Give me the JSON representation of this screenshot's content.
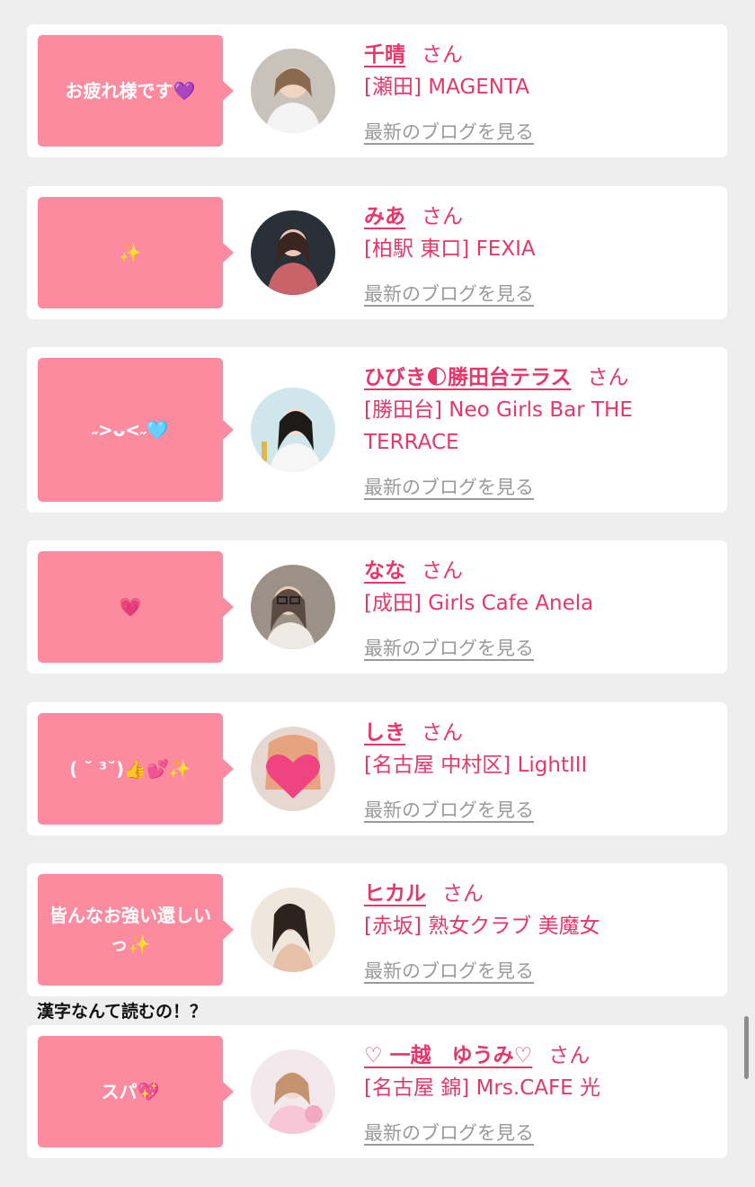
{
  "blog_link_label": "最新のブログを見る",
  "san_label": "さん",
  "colors": {
    "bubble": "#fc8b9f",
    "name": "#e8366a",
    "link": "#9a9a9a",
    "background": "#eeeeee"
  },
  "cards": [
    {
      "message": "お疲れ様です💜",
      "name": "千晴",
      "shop": "[瀬田] MAGENTA",
      "avatar_icon": "woman-photo-avatar-icon"
    },
    {
      "message": "✨",
      "name": "みあ",
      "shop": "[柏駅 東口] FEXIA",
      "avatar_icon": "woman-photo-avatar-icon"
    },
    {
      "message": "˶>ᴗ<˶🩵",
      "name": "ひびき🌓勝田台テラス",
      "shop": "[勝田台] Neo Girls Bar THE TERRACE",
      "avatar_icon": "woman-photo-avatar-icon"
    },
    {
      "message": "💗",
      "name": "なな",
      "shop": "[成田] Girls Cafe Anela",
      "avatar_icon": "woman-photo-avatar-icon"
    },
    {
      "message": "( ˘ ³˘)👍💕✨",
      "name": "しき",
      "shop": "[名古屋 中村区] LightIII",
      "avatar_icon": "heart-avatar-icon"
    },
    {
      "message": "皆んなお強い還しいっ✨",
      "name": "ヒカル",
      "shop": "[赤坂] 熟女クラブ 美魔女",
      "avatar_icon": "woman-photo-avatar-icon"
    },
    {
      "message": "スパ💖",
      "name": "♡ 一越　ゆうみ♡",
      "shop": "[名古屋 錦] Mrs.CAFE 光",
      "avatar_icon": "woman-photo-avatar-icon"
    }
  ],
  "comment_text": "漢字なんて読むの！？"
}
